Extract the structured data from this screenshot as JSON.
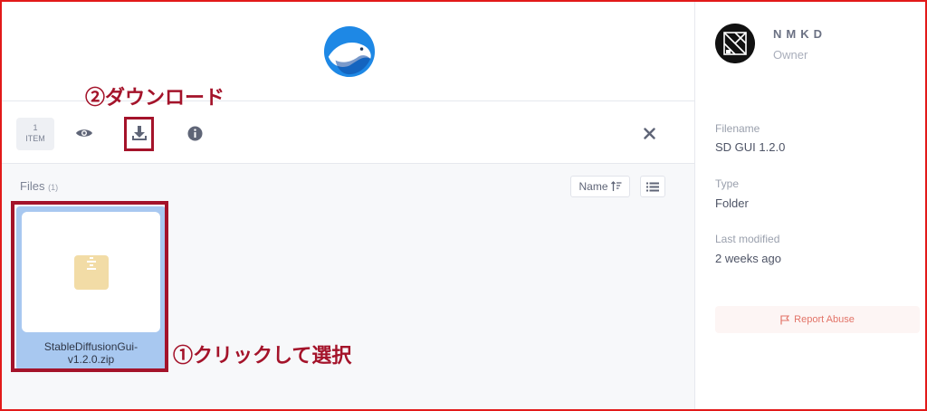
{
  "toolbar": {
    "item_count": "1",
    "item_label": "ITEM",
    "icons": [
      "eye-icon",
      "download-icon",
      "info-icon",
      "close-icon"
    ]
  },
  "files": {
    "heading": "Files",
    "count": "(1)",
    "sort_label": "Name",
    "items": [
      {
        "name_line1": "StableDiffusionGui-",
        "name_line2": "v1.2.0.zip",
        "icon": "zip-archive-icon"
      }
    ]
  },
  "annotations": {
    "download": "②ダウンロード",
    "click": "①クリックして選択"
  },
  "sidebar": {
    "owner_name": "NMKD",
    "owner_role": "Owner",
    "filename_label": "Filename",
    "filename_value": "SD GUI 1.2.0",
    "type_label": "Type",
    "type_value": "Folder",
    "modified_label": "Last modified",
    "modified_value": "2 weeks ago",
    "report_label": "Report Abuse"
  },
  "colors": {
    "accent_blue": "#1e88e5",
    "selection": "#a8c8f0",
    "annotation": "#a4132a",
    "report": "#e27468",
    "frame": "#e21a1a"
  }
}
